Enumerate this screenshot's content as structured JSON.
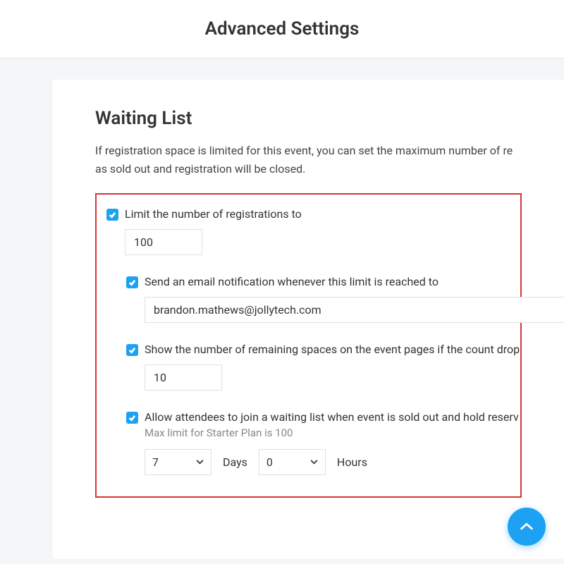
{
  "header": {
    "title": "Advanced Settings"
  },
  "section": {
    "title": "Waiting List",
    "desc_line1": "If registration space is limited for this event, you can set the maximum number of re",
    "desc_line2": "as sold out and registration will be closed."
  },
  "limit": {
    "label": "Limit the number of registrations to",
    "value": "100",
    "checked": true
  },
  "notify": {
    "label": "Send an email notification whenever this limit is reached to",
    "email": "brandon.mathews@jollytech.com",
    "checked": true
  },
  "remaining": {
    "label": "Show the number of remaining spaces on the event pages if the count drop",
    "value": "10",
    "checked": true
  },
  "waiting": {
    "label": "Allow attendees to join a waiting list when event is sold out and hold reserv",
    "hint": "Max limit for Starter Plan is 100",
    "checked": true,
    "days_value": "7",
    "days_label": "Days",
    "hours_value": "0",
    "hours_label": "Hours"
  }
}
